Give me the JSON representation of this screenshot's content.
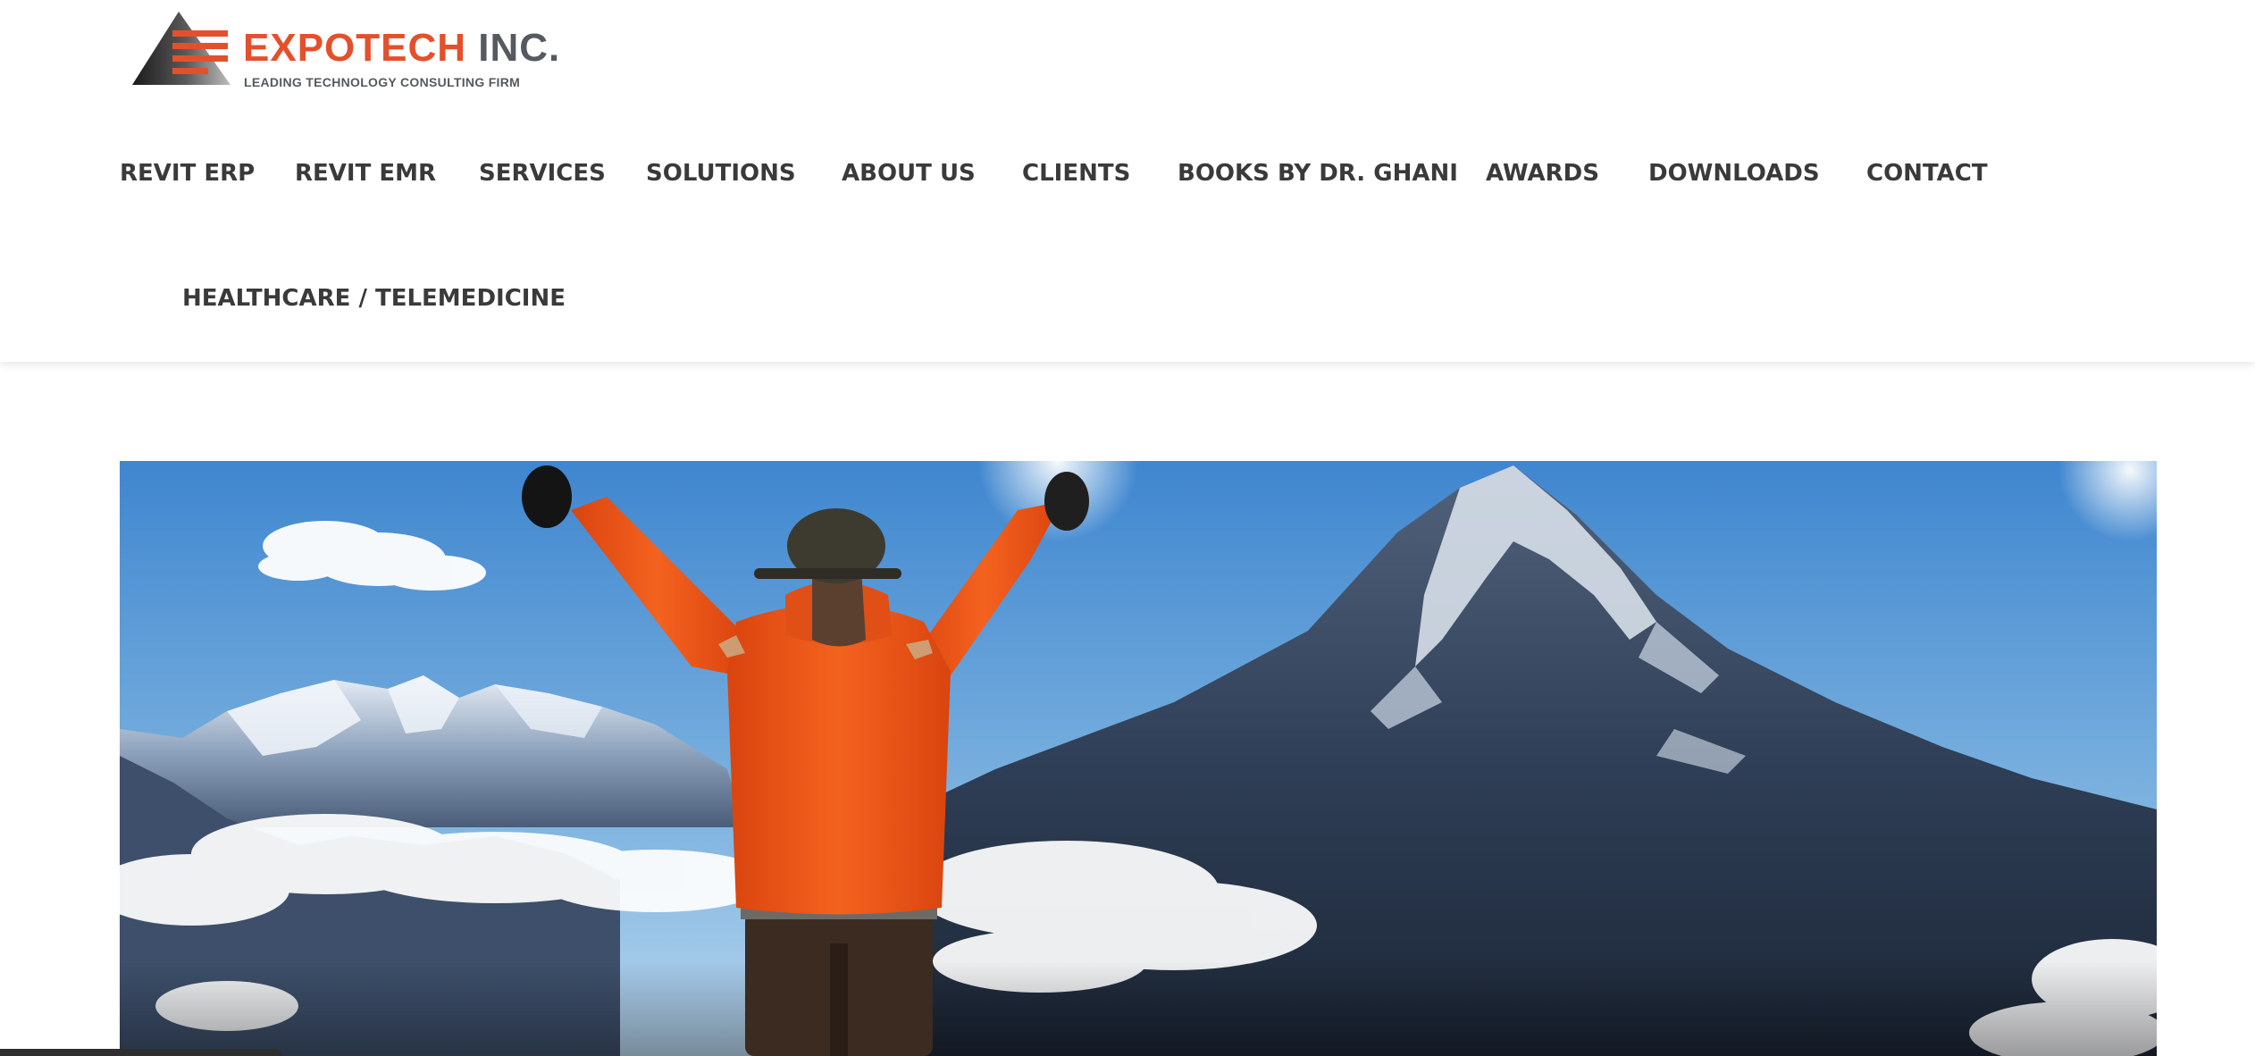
{
  "header": {
    "logo": {
      "name_brand": "EXPOTECH",
      "name_suffix": "INC.",
      "tagline": "LEADING TECHNOLOGY CONSULTING FIRM"
    },
    "nav": {
      "items": [
        "REVIT ERP",
        "REVIT EMR",
        "SERVICES",
        "SOLUTIONS",
        "ABOUT US",
        "CLIENTS",
        "BOOKS BY DR. GHANI",
        "AWARDS",
        "DOWNLOADS",
        "CONTACT",
        "HEALTHCARE / TELEMEDICINE"
      ]
    }
  },
  "hero": {
    "image": "mountain-summit-hiker"
  },
  "colors": {
    "brand_orange": "#e4502c",
    "logo_gray": "#555a60",
    "nav_text": "#3a3a3a",
    "sky": "#4f8fcf",
    "jacket": "#f0561c"
  }
}
